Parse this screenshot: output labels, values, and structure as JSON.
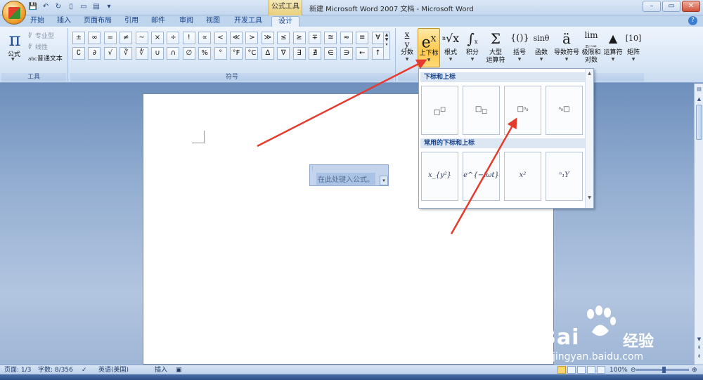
{
  "window": {
    "title": "新建 Microsoft Word 2007 文档 - Microsoft Word",
    "context_tab": "公式工具"
  },
  "tabs": [
    "开始",
    "插入",
    "页面布局",
    "引用",
    "邮件",
    "审阅",
    "视图",
    "开发工具",
    "设计"
  ],
  "active_tab": "设计",
  "tools_group": {
    "label": "工具",
    "equation_label": "公式",
    "items": [
      "专业型",
      "线性",
      "普通文本"
    ]
  },
  "symbols_group": {
    "label": "符号",
    "row1": [
      "±",
      "∞",
      "=",
      "≠",
      "~",
      "×",
      "÷",
      "!",
      "∝",
      "<",
      "≪",
      ">",
      "≫",
      "≤",
      "≥",
      "∓",
      "≅",
      "≈",
      "≡",
      "∀"
    ],
    "row2": [
      "∁",
      "∂",
      "√",
      "∛",
      "∜",
      "∪",
      "∩",
      "∅",
      "%",
      "°",
      "°F",
      "°C",
      "∆",
      "∇",
      "∃",
      "∄",
      "∈",
      "∋",
      "←",
      "↑"
    ]
  },
  "structures": [
    {
      "id": "fraction",
      "label": "分数",
      "glyph": "x/y"
    },
    {
      "id": "script",
      "label": "上下标",
      "glyph": "eˣ"
    },
    {
      "id": "radical",
      "label": "根式",
      "glyph": "ⁿ√x"
    },
    {
      "id": "integral",
      "label": "积分",
      "glyph": "∫"
    },
    {
      "id": "large-operator",
      "label": "大型\n运算符",
      "glyph": "Σ"
    },
    {
      "id": "bracket",
      "label": "括号",
      "glyph": "{()}"
    },
    {
      "id": "function",
      "label": "函数",
      "glyph": "sinθ"
    },
    {
      "id": "accent",
      "label": "导数符号",
      "glyph": "ä"
    },
    {
      "id": "limit-log",
      "label": "极限和\n对数",
      "glyph": "lim"
    },
    {
      "id": "operator",
      "label": "运算符",
      "glyph": "▲"
    },
    {
      "id": "matrix",
      "label": "矩阵",
      "glyph": "[10]"
    }
  ],
  "gallery": {
    "section1": "下标和上标",
    "section2": "常用的下标和上标",
    "common": [
      "x_{y²}",
      "e^{−iωt}",
      "x²",
      "ⁿ₁Y"
    ]
  },
  "document": {
    "placeholder": "在此处键入公式。"
  },
  "status": {
    "page": "页面: 1/3",
    "words": "字数: 8/356",
    "language": "英语(美国)",
    "mode": "插入",
    "zoom": "100%"
  },
  "watermark": {
    "brand": "Bai",
    "brand_cn": "经验",
    "url": "jingyan.baidu.com"
  },
  "colors": {
    "ribbon_bg": "#d8e6f6",
    "highlight": "#ffc84a",
    "arrow": "#e53b2e"
  }
}
